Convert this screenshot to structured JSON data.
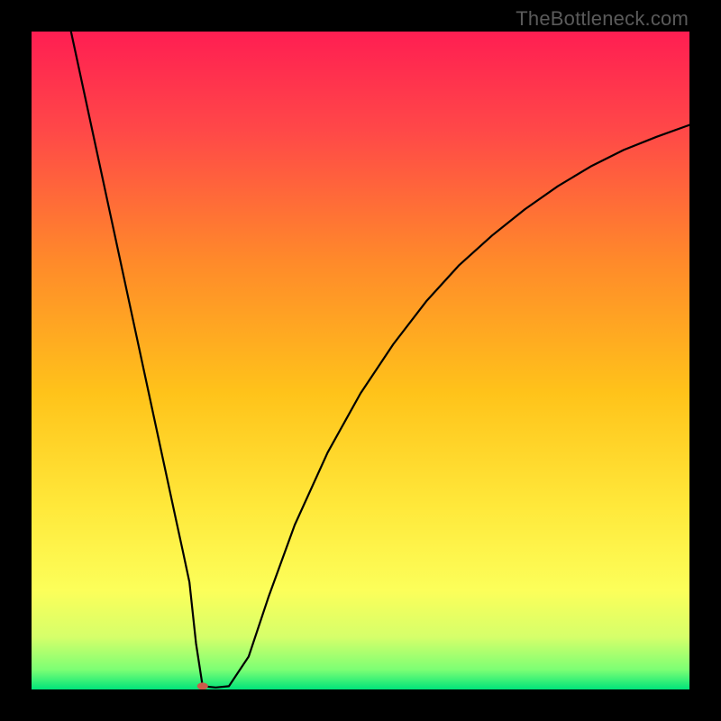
{
  "watermark": "TheBottleneck.com",
  "chart_data": {
    "type": "line",
    "title": "",
    "xlabel": "",
    "ylabel": "",
    "xlim": [
      0,
      100
    ],
    "ylim": [
      0,
      100
    ],
    "grid": false,
    "legend": false,
    "gradient_stops": [
      {
        "offset": 0.0,
        "color": "#ff1e52"
      },
      {
        "offset": 0.15,
        "color": "#ff4848"
      },
      {
        "offset": 0.35,
        "color": "#ff8a2a"
      },
      {
        "offset": 0.55,
        "color": "#ffc31a"
      },
      {
        "offset": 0.72,
        "color": "#ffe83a"
      },
      {
        "offset": 0.85,
        "color": "#fcff5a"
      },
      {
        "offset": 0.92,
        "color": "#d6ff6a"
      },
      {
        "offset": 0.97,
        "color": "#7cff74"
      },
      {
        "offset": 1.0,
        "color": "#00e47a"
      }
    ],
    "series": [
      {
        "name": "curve",
        "color": "#000000",
        "x": [
          6,
          8,
          10,
          12,
          14,
          16,
          18,
          20,
          22,
          23,
          24,
          25,
          26,
          28,
          30,
          33,
          36,
          40,
          45,
          50,
          55,
          60,
          65,
          70,
          75,
          80,
          85,
          90,
          95,
          100
        ],
        "y": [
          100,
          90.7,
          81.4,
          72.1,
          62.8,
          53.5,
          44.2,
          34.9,
          25.6,
          21.0,
          16.3,
          7.0,
          0.5,
          0.3,
          0.5,
          5.0,
          14.0,
          25.0,
          36.0,
          45.0,
          52.5,
          59.0,
          64.5,
          69.0,
          73.0,
          76.5,
          79.5,
          82.0,
          84.0,
          85.8
        ]
      }
    ],
    "marker": {
      "x": 26,
      "y": 0.5,
      "color": "#cc5a4a",
      "rx": 6,
      "ry": 4
    }
  }
}
